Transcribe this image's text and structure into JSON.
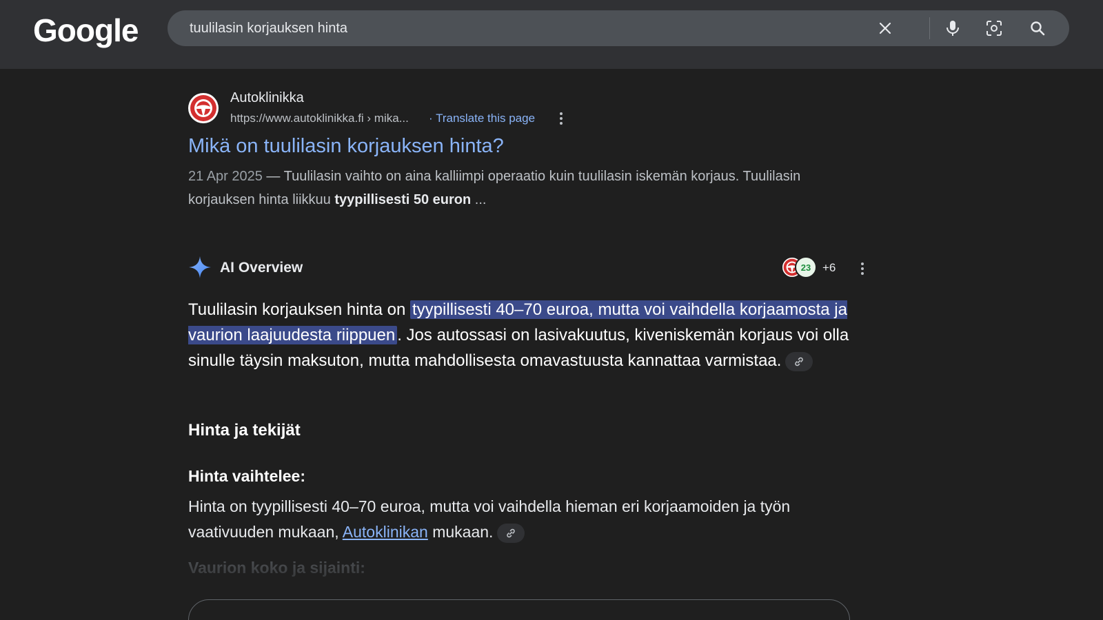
{
  "header": {
    "logo": "Google",
    "search_query": "tuulilasin korjauksen hinta",
    "icons": [
      "close-icon",
      "microphone-icon",
      "lens-icon",
      "search-icon"
    ]
  },
  "result": {
    "site_name": "Autoklinikka",
    "url": "https://www.autoklinikka.fi › mika...",
    "translate": "· Translate this page",
    "title": "Mikä on tuulilasin korjauksen hinta?",
    "date": "21 Apr 2025",
    "snippet_text": " — Tuulilasin vaihto on aina kalliimpi operaatio kuin tuulilasin iskemän korjaus. Tuulilasin korjauksen hinta liikkuu ",
    "snippet_bold": "tyypillisesti 50 euron",
    "snippet_end": " ..."
  },
  "ai_overview": {
    "title": "AI Overview",
    "source_badge": "23",
    "source_more": "+6",
    "para_start": "Tuulilasin korjauksen hinta on ",
    "para_highlight": "tyypillisesti 40–70 euroa, mutta voi vaihdella korjaamosta ja vaurion laajuudesta riippuen",
    "para_end": ". Jos autossasi on lasivakuutus, kiveniskemän korjaus voi olla sinulle täysin maksuton, mutta mahdollisesta omavastuusta kannattaa varmistaa.",
    "section_heading": "Hinta ja tekijät",
    "sub_heading": "Hinta vaihtelee:",
    "para2_start": "Hinta on tyypillisesti 40–70 euroa, mutta voi vaihdella hieman eri korjaamoiden ja työn vaativuuden mukaan, ",
    "para2_link": "Autoklinikan",
    "para2_end": " mukaan.",
    "faded_heading": "Vaurion koko ja sijainti:"
  },
  "colors": {
    "background": "#1f1f1f",
    "header": "#303134",
    "link": "#8ab4f8",
    "highlight": "#3b4a8a"
  }
}
